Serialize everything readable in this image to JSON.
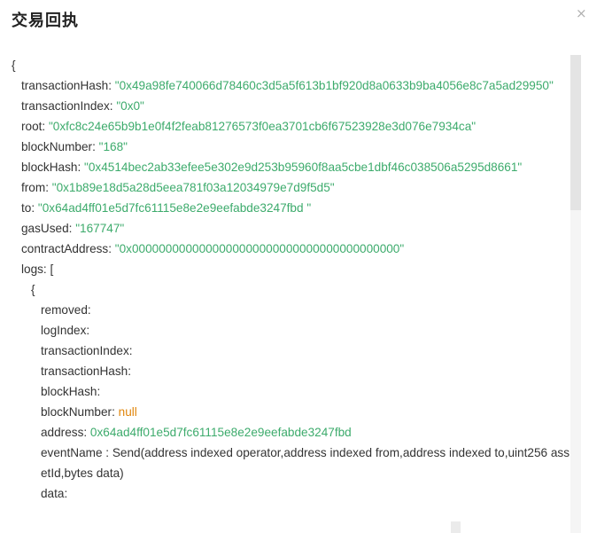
{
  "dialog": {
    "title": "交易回执",
    "close_glyph": "×"
  },
  "receipt": {
    "open_brace": "{",
    "transactionHash": {
      "key": "transactionHash:",
      "value": "\"0x49a98fe740066d78460c3d5a5f613b1bf920d8a0633b9ba4056e8c7a5ad29950\""
    },
    "transactionIndex": {
      "key": "transactionIndex:",
      "value": "\"0x0\""
    },
    "root": {
      "key": "root:",
      "value": "\"0xfc8c24e65b9b1e0f4f2feab81276573f0ea3701cb6f67523928e3d076e7934ca\""
    },
    "blockNumber": {
      "key": "blockNumber:",
      "value": "\"168\""
    },
    "blockHash": {
      "key": "blockHash:",
      "value": "\"0x4514bec2ab33efee5e302e9d253b95960f8aa5cbe1dbf46c038506a5295d8661\""
    },
    "from": {
      "key": "from:",
      "value": "\"0x1b89e18d5a28d5eea781f03a12034979e7d9f5d5\""
    },
    "to": {
      "key": "to:",
      "value": "\"0x64ad4ff01e5d7fc61115e8e2e9eefabde3247fbd \""
    },
    "gasUsed": {
      "key": "gasUsed:",
      "value": "\"167747\""
    },
    "contractAddress": {
      "key": "contractAddress:",
      "value": "\"0x0000000000000000000000000000000000000000\""
    },
    "logs_open": "logs: [",
    "log_open_brace": "{",
    "log": {
      "removed": "removed:",
      "logIndex": "logIndex:",
      "transactionIndex": "transactionIndex:",
      "transactionHash": "transactionHash:",
      "blockHash": "blockHash:",
      "blockNumber": {
        "key": "blockNumber:",
        "value": "null"
      },
      "address": {
        "key": "address:",
        "value": "0x64ad4ff01e5d7fc61115e8e2e9eefabde3247fbd"
      },
      "eventName": {
        "key": "eventName :",
        "value": "Send(address indexed operator,address indexed from,address indexed to,uint256 assetId,bytes data)"
      },
      "data": "data:"
    }
  },
  "colors": {
    "string": "#3dab6c",
    "null": "#e0860c",
    "text": "#333333"
  }
}
